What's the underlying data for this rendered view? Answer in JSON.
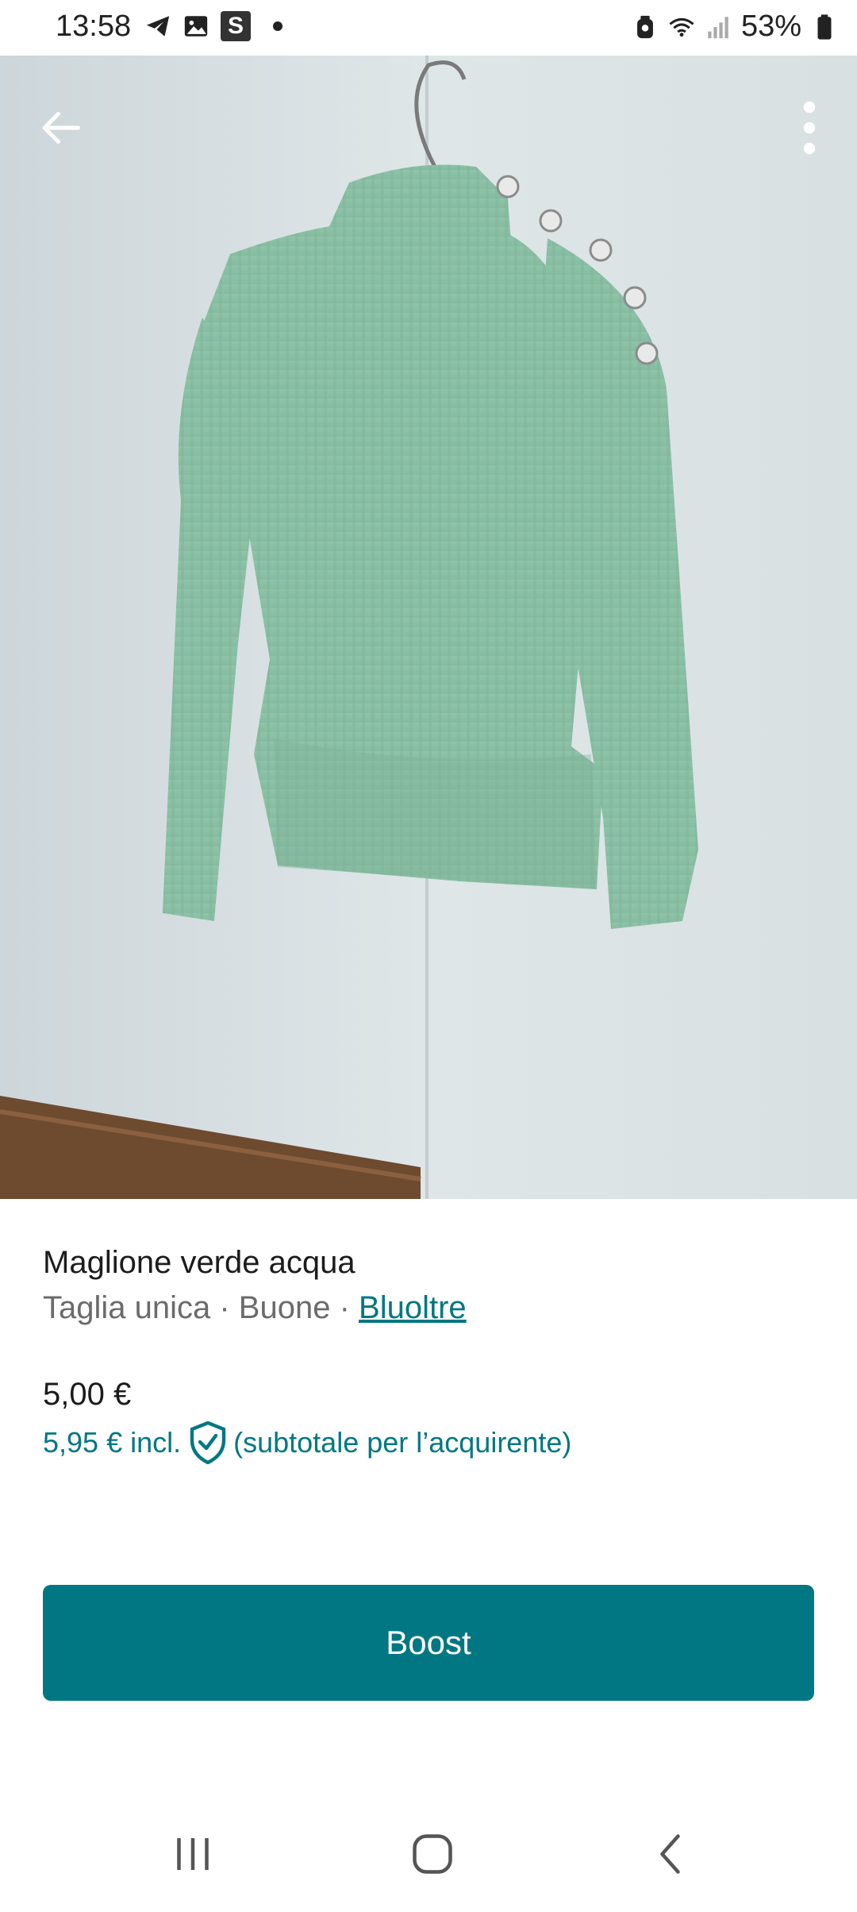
{
  "status_bar": {
    "time": "13:58",
    "left_icons": [
      "telegram-icon",
      "gallery-icon",
      "s-app-icon",
      "notification-dot-icon"
    ],
    "s_badge": "S",
    "right_icons": [
      "alarm-icon",
      "wifi-icon",
      "signal-icon",
      "battery-icon"
    ],
    "battery": "53%"
  },
  "header": {
    "back_icon": "arrow-left-icon",
    "menu_icon": "more-vertical-icon"
  },
  "photo": {
    "subject": "product-photo"
  },
  "product": {
    "title": "Maglione verde acqua",
    "size": "Taglia unica",
    "separator1": " · ",
    "condition": "Buone",
    "separator2": " · ",
    "brand": "Bluoltre",
    "price": "5,00 €",
    "price_incl": "5,95 € incl.",
    "buyer_note": "(subtotale per l’acquirente)"
  },
  "actions": {
    "boost_label": "Boost"
  },
  "colors": {
    "accent": "#007782",
    "text_primary": "#1c1c1c",
    "text_secondary": "#6b6b6b"
  },
  "nav": {
    "recents_icon": "recents-icon",
    "home_icon": "home-icon",
    "back_icon": "back-icon"
  }
}
